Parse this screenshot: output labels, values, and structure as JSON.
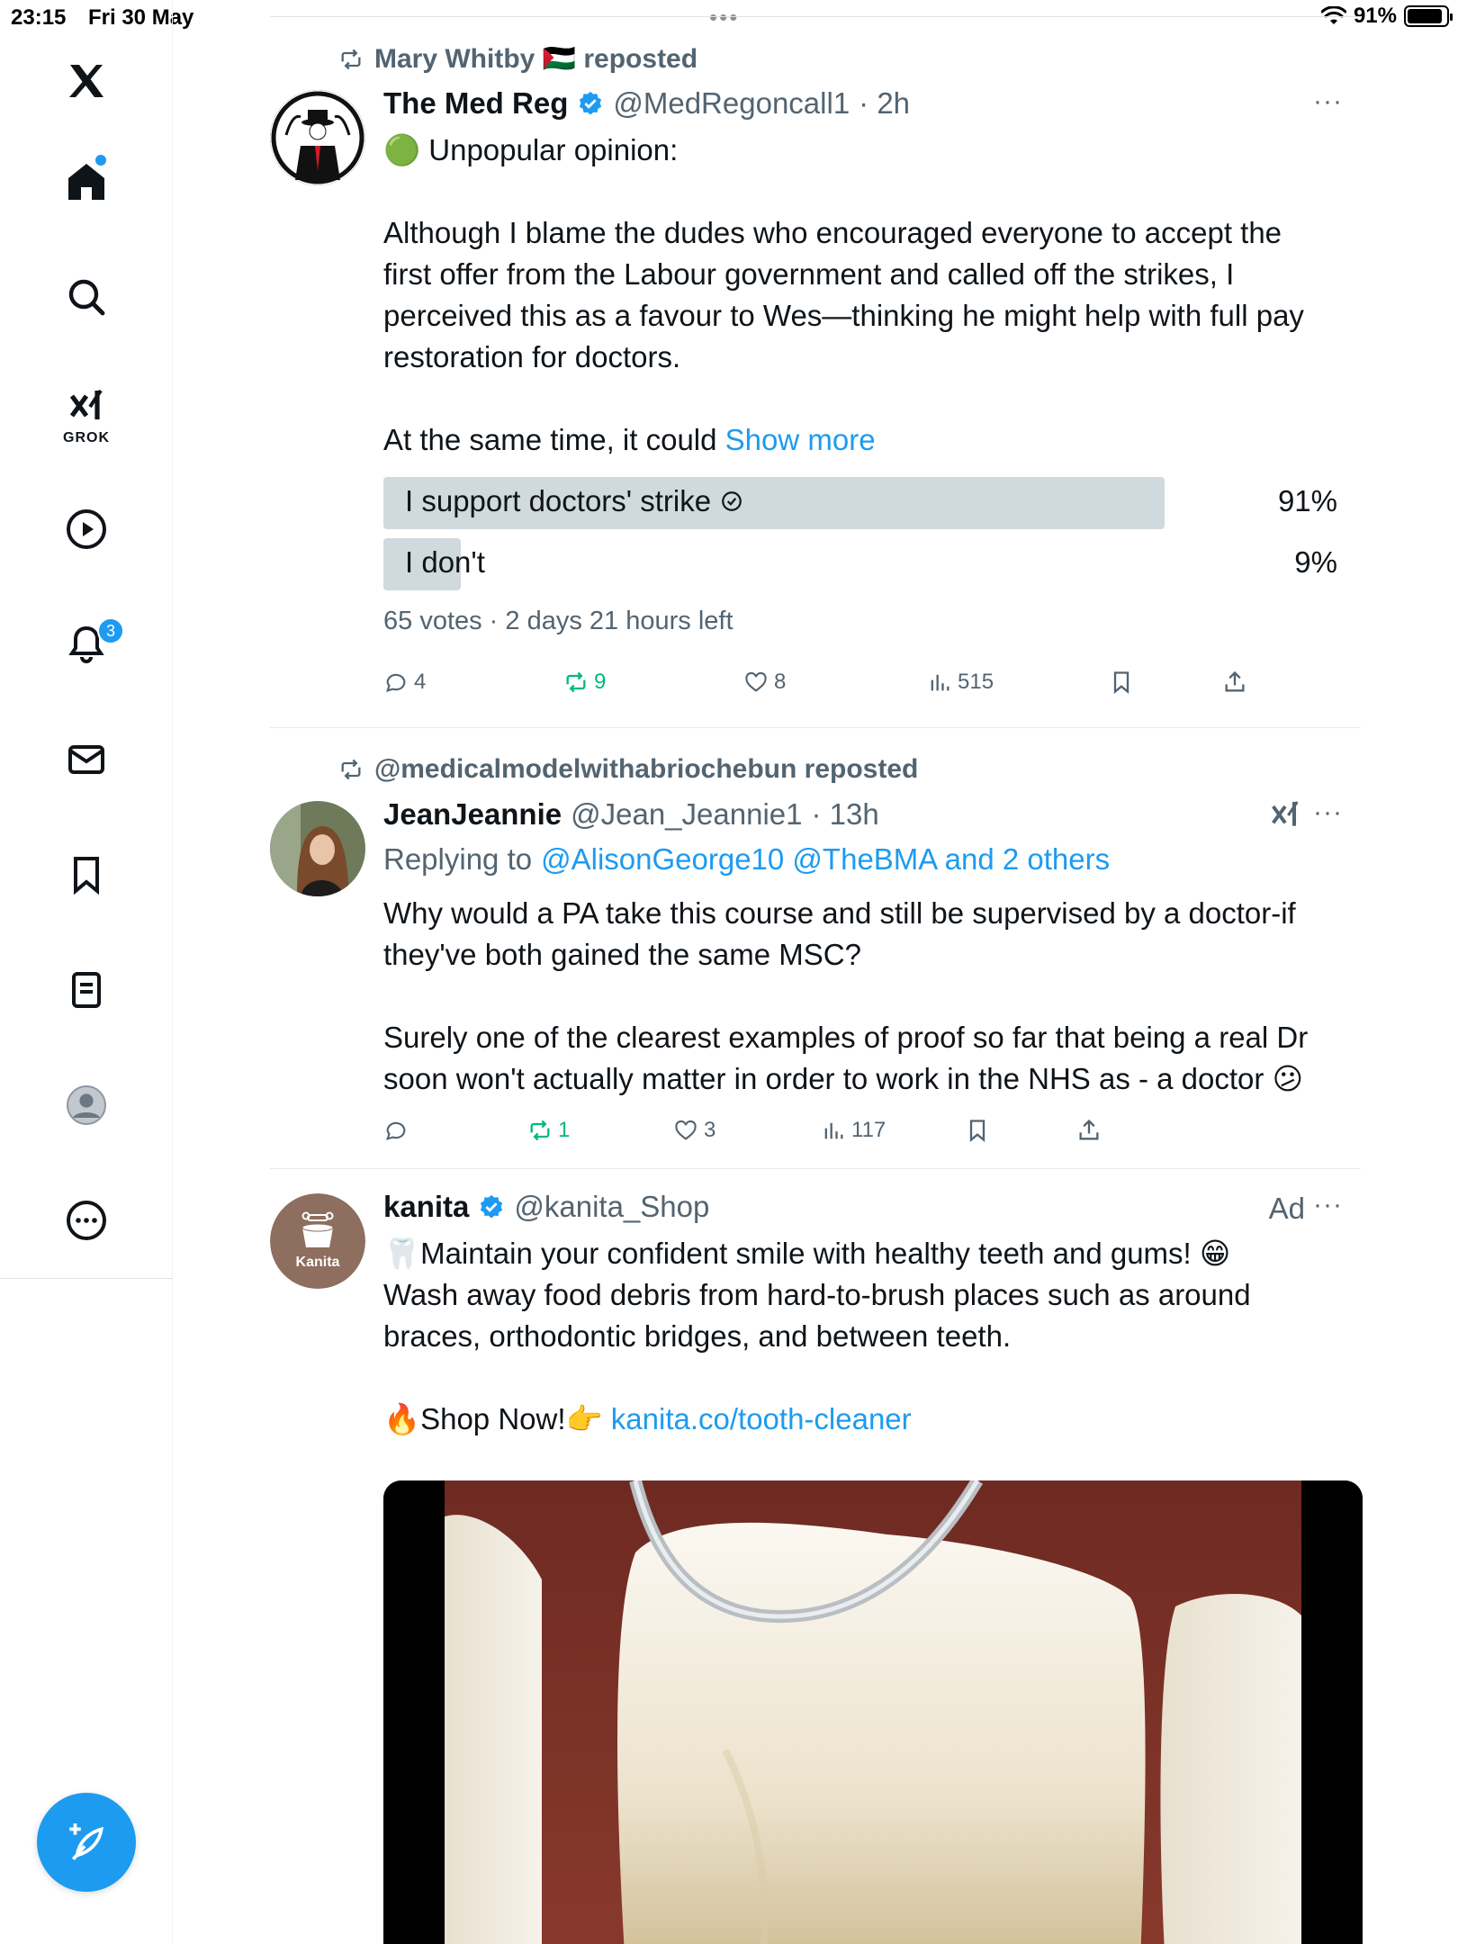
{
  "status_bar": {
    "time": "23:15",
    "date": "Fri 30 May",
    "battery_pct": "91%",
    "battery_level": 0.91
  },
  "sidebar": {
    "items": [
      {
        "name": "home",
        "icon": "home-icon",
        "has_dot": true
      },
      {
        "name": "search",
        "icon": "search-icon"
      },
      {
        "name": "grok",
        "icon": "grok-icon",
        "label": "GROK"
      },
      {
        "name": "videos",
        "icon": "play-icon"
      },
      {
        "name": "notifications",
        "icon": "bell-icon",
        "badge": "3"
      },
      {
        "name": "messages",
        "icon": "mail-icon"
      },
      {
        "name": "bookmarks",
        "icon": "bookmark-icon"
      },
      {
        "name": "lists",
        "icon": "list-icon"
      },
      {
        "name": "profile",
        "icon": "avatar-icon"
      },
      {
        "name": "more",
        "icon": "more-circle-icon"
      }
    ],
    "compose_icon": "compose-feather-icon"
  },
  "posts": [
    {
      "repost_by": "Mary Whitby 🇵🇸 reposted",
      "name": "The Med Reg",
      "handle": "@MedRegoncall1",
      "time": "· 2h",
      "verified": true,
      "text": [
        "🟢 Unpopular opinion:",
        "",
        "Although I blame the dudes who encouraged everyone to accept the first offer from the Labour government and called off the strikes, I perceived this as a favour to Wes—thinking he might help with full pay restoration for doctors.",
        "",
        "At the same time, it could"
      ],
      "show_more": "Show more",
      "poll": {
        "options": [
          {
            "label": "I support doctors' strike",
            "pct": "91%",
            "value": 0.91,
            "winner": true
          },
          {
            "label": "I don't",
            "pct": "9%",
            "value": 0.09,
            "winner": false
          }
        ],
        "meta": "65 votes · 2 days 21 hours left"
      },
      "actions": {
        "replies": "4",
        "reposts": "9",
        "likes": "8",
        "views": "515"
      }
    },
    {
      "repost_by": "@medicalmodelwithabriochebun reposted",
      "name": "JeanJeannie",
      "handle": "@Jean_Jeannie1",
      "time": "· 13h",
      "replying_prefix": "Replying to",
      "replying_to": "@AlisonGeorge10 @TheBMA and 2 others",
      "text": [
        "Why would a PA take this course and still be supervised by a doctor-if they've both gained the same MSC?",
        "",
        "Surely one of the clearest examples of proof so far that being a real Dr soon won't actually matter in order to work in the NHS as - a doctor 😕"
      ],
      "actions": {
        "replies": "",
        "reposts": "1",
        "likes": "3",
        "views": "117"
      }
    },
    {
      "name": "kanita",
      "handle": "@kanita_Shop",
      "verified": true,
      "ad_label": "Ad",
      "avatar_text": "Kanita",
      "avatar_color": "#8d6e5f",
      "text_line1": "🦷Maintain your confident smile with healthy teeth and gums! 😁",
      "text_line2": "Wash away food debris from hard-to-brush places such as around braces, orthodontic bridges, and between teeth.",
      "shop_prefix": "🔥Shop Now!👉",
      "shop_link": "kanita.co/tooth-cleaner"
    }
  ],
  "colors": {
    "accent": "#1d9bf0",
    "repost_green": "#00ba7c",
    "muted": "#536471",
    "poll_bar": "#cfd9de"
  }
}
